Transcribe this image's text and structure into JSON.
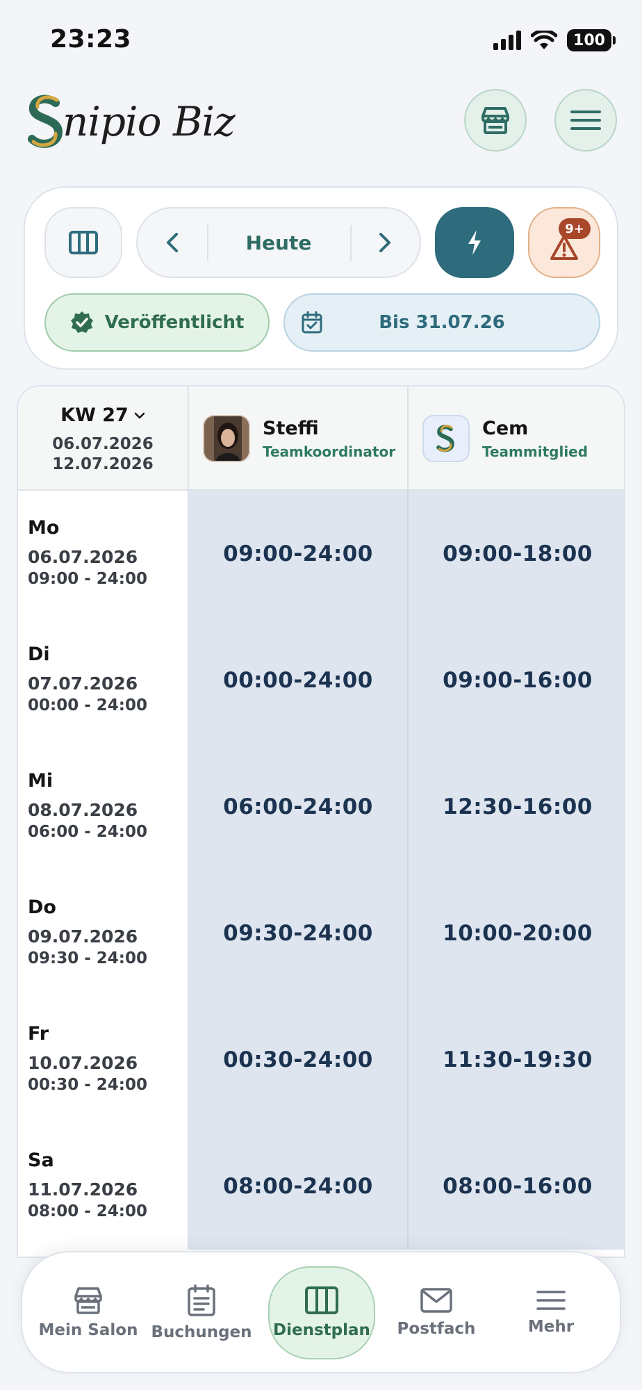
{
  "status_bar": {
    "time": "23:23",
    "battery": "100"
  },
  "header": {
    "logo_text": "nipio Biz",
    "logo_initial": "S"
  },
  "controls": {
    "today_label": "Heute",
    "notifications_badge": "9+",
    "published_label": "Veröffentlicht",
    "until_label": "Bis 31.07.26"
  },
  "table": {
    "week": {
      "label": "KW 27",
      "start": "06.07.2026",
      "end": "12.07.2026"
    },
    "employees": [
      {
        "name": "Steffi",
        "role": "Teamkoordinator"
      },
      {
        "name": "Cem",
        "role": "Teammitglied"
      }
    ],
    "days": [
      {
        "name": "Mo",
        "date": "06.07.2026",
        "range": "09:00 - 24:00",
        "shifts": [
          "09:00-24:00",
          "09:00-18:00"
        ]
      },
      {
        "name": "Di",
        "date": "07.07.2026",
        "range": "00:00 - 24:00",
        "shifts": [
          "00:00-24:00",
          "09:00-16:00"
        ]
      },
      {
        "name": "Mi",
        "date": "08.07.2026",
        "range": "06:00 - 24:00",
        "shifts": [
          "06:00-24:00",
          "12:30-16:00"
        ]
      },
      {
        "name": "Do",
        "date": "09.07.2026",
        "range": "09:30 - 24:00",
        "shifts": [
          "09:30-24:00",
          "10:00-20:00"
        ]
      },
      {
        "name": "Fr",
        "date": "10.07.2026",
        "range": "00:30 - 24:00",
        "shifts": [
          "00:30-24:00",
          "11:30-19:30"
        ]
      },
      {
        "name": "Sa",
        "date": "11.07.2026",
        "range": "08:00 - 24:00",
        "shifts": [
          "08:00-24:00",
          "08:00-16:00"
        ]
      }
    ]
  },
  "bottom_nav": {
    "items": [
      {
        "label": "Mein Salon",
        "icon": "store-icon"
      },
      {
        "label": "Buchungen",
        "icon": "clipboard-icon"
      },
      {
        "label": "Dienstplan",
        "icon": "columns-icon",
        "active": true
      },
      {
        "label": "Postfach",
        "icon": "mail-icon"
      },
      {
        "label": "Mehr",
        "icon": "menu-icon"
      }
    ]
  },
  "colors": {
    "accent_green": "#2f6d4e",
    "accent_teal": "#2e6b7c",
    "shift_bg": "#dee5ef",
    "shift_text": "#1b3350",
    "warning": "#a8472a"
  }
}
